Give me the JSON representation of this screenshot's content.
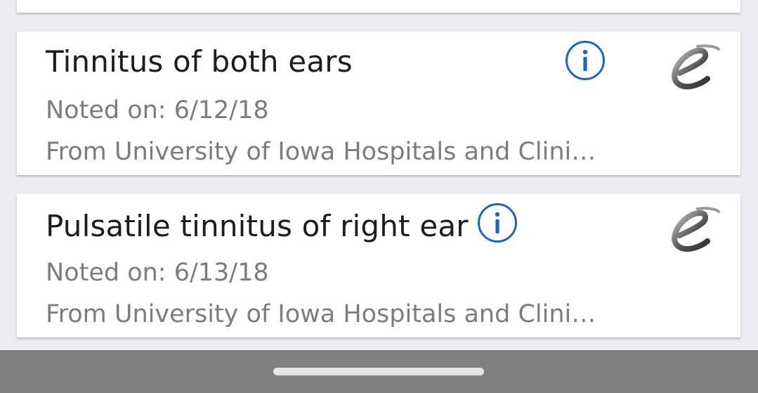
{
  "colors": {
    "background": "#ecebf1",
    "card": "#ffffff",
    "title_text": "#1d1d1d",
    "meta_text": "#7c7c7c",
    "info_blue": "#1f63c6",
    "nav_bar": "#808080",
    "home_handle": "#e4e4e4"
  },
  "problems": [
    {
      "title": "Tinnitus of both ears",
      "noted": "Noted on: 6/12/18",
      "source": "From University of Iowa Hospitals and Clini…",
      "info_icon": "info-icon",
      "logo_icon": "epic-logo-icon"
    },
    {
      "title": "Pulsatile tinnitus of right ear",
      "noted": "Noted on: 6/13/18",
      "source": "From University of Iowa Hospitals and Clini…",
      "info_icon": "info-icon",
      "logo_icon": "epic-logo-icon"
    }
  ],
  "nav": {
    "handle_icon": "home-handle"
  }
}
